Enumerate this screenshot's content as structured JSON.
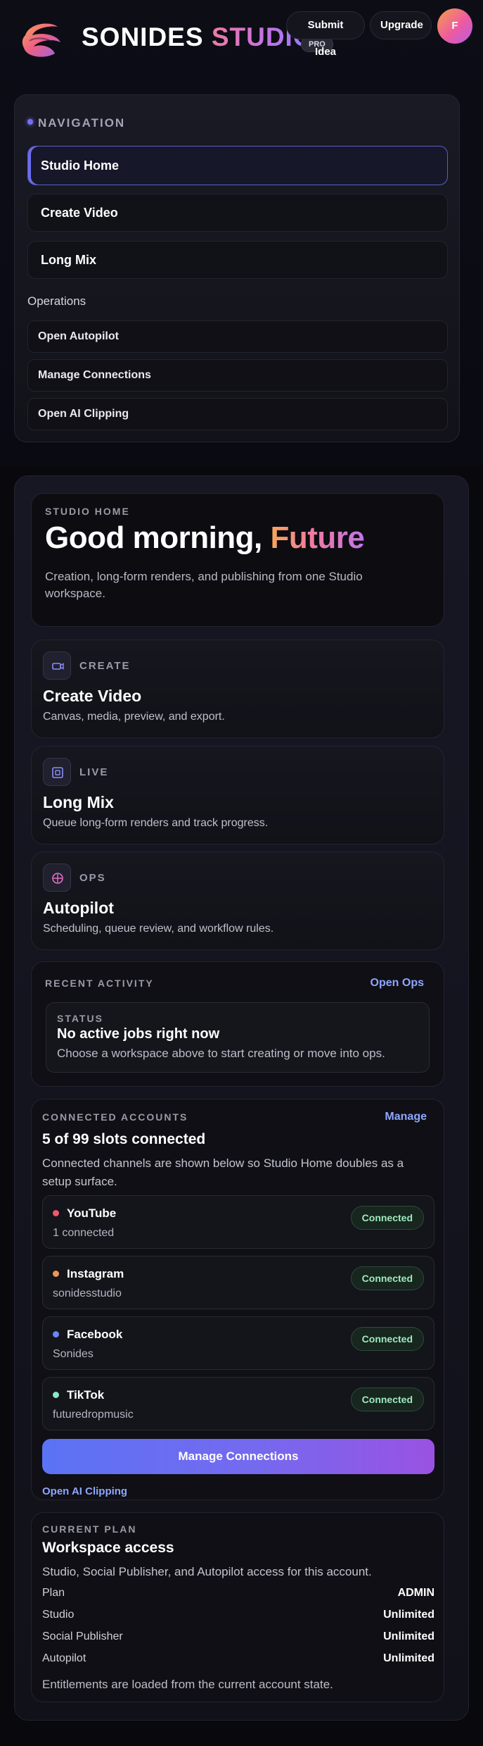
{
  "header": {
    "brand_word1": "SONIDES",
    "brand_word2": "STUDIO",
    "badge": "PRO",
    "submit_idea": "Submit Idea",
    "upgrade": "Upgrade",
    "avatar_initial": "F",
    "logo_icon": "sonides-wave-logo"
  },
  "nav": {
    "title": "NAVIGATION",
    "items": [
      {
        "label": "Studio Home",
        "active": true
      },
      {
        "label": "Create Video",
        "active": false
      },
      {
        "label": "Long Mix",
        "active": false
      }
    ],
    "ops_label": "Operations",
    "ops_items": [
      "Open Autopilot",
      "Manage Connections",
      "Open AI Clipping"
    ]
  },
  "hero": {
    "eyebrow": "STUDIO HOME",
    "greeting": "Good morning, ",
    "name": "Future",
    "subtitle": "Creation, long-form renders, and publishing from one Studio workspace."
  },
  "features": [
    {
      "eyebrow": "CREATE",
      "title": "Create Video",
      "desc": "Canvas, media, preview, and export.",
      "icon": "video-camera-icon",
      "accent": "#8b8ff5"
    },
    {
      "eyebrow": "LIVE",
      "title": "Long Mix",
      "desc": "Queue long-form renders and track progress.",
      "icon": "grid-square-icon",
      "accent": "#8b8ff5"
    },
    {
      "eyebrow": "OPS",
      "title": "Autopilot",
      "desc": "Scheduling, queue review, and workflow rules.",
      "icon": "crosshair-circle-icon",
      "accent": "#e46fc4"
    }
  ],
  "activity": {
    "eyebrow": "RECENT ACTIVITY",
    "link": "Open Ops",
    "status_eyebrow": "STATUS",
    "status_title": "No active jobs right now",
    "status_desc": "Choose a workspace above to start creating or move into ops."
  },
  "accounts": {
    "eyebrow": "CONNECTED ACCOUNTS",
    "link": "Manage",
    "title": "5 of 99 slots connected",
    "desc": "Connected channels are shown below so Studio Home doubles as a setup surface.",
    "rows": [
      {
        "name": "YouTube",
        "sub": "1 connected",
        "status": "Connected",
        "dot": "#f0586f"
      },
      {
        "name": "Instagram",
        "sub": "sonidesstudio",
        "status": "Connected",
        "dot": "#f29455"
      },
      {
        "name": "Facebook",
        "sub": "Sonides",
        "status": "Connected",
        "dot": "#6a86f3"
      },
      {
        "name": "TikTok",
        "sub": "futuredropmusic",
        "status": "Connected",
        "dot": "#8ee6c6"
      }
    ],
    "manage_button": "Manage Connections",
    "clip_link": "Open AI Clipping"
  },
  "plan": {
    "eyebrow": "CURRENT PLAN",
    "title": "Workspace access",
    "desc": "Studio, Social Publisher, and Autopilot access for this account.",
    "rows": [
      {
        "key": "Plan",
        "value": "ADMIN"
      },
      {
        "key": "Studio",
        "value": "Unlimited"
      },
      {
        "key": "Social Publisher",
        "value": "Unlimited"
      },
      {
        "key": "Autopilot",
        "value": "Unlimited"
      }
    ],
    "footer": "Entitlements are loaded from the current account state."
  }
}
